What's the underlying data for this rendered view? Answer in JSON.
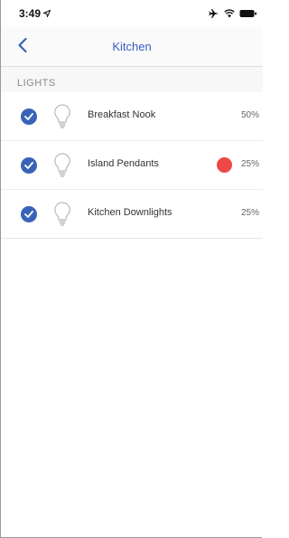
{
  "status_bar": {
    "time": "3:49",
    "icons": [
      "location-arrow-icon",
      "airplane-icon",
      "wifi-icon",
      "battery-icon"
    ]
  },
  "nav": {
    "title": "Kitchen",
    "back_icon": "chevron-left-icon"
  },
  "section": {
    "header": "LIGHTS"
  },
  "lights": [
    {
      "name": "Breakfast Nook",
      "level": "50%",
      "selected": true,
      "color_dot": null
    },
    {
      "name": "Island Pendants",
      "level": "25%",
      "selected": true,
      "color_dot": "#f04747"
    },
    {
      "name": "Kitchen Downlights",
      "level": "25%",
      "selected": true,
      "color_dot": null
    }
  ],
  "colors": {
    "accent": "#3a63b8",
    "title": "#3b5bbf",
    "dot": "#f04747"
  }
}
